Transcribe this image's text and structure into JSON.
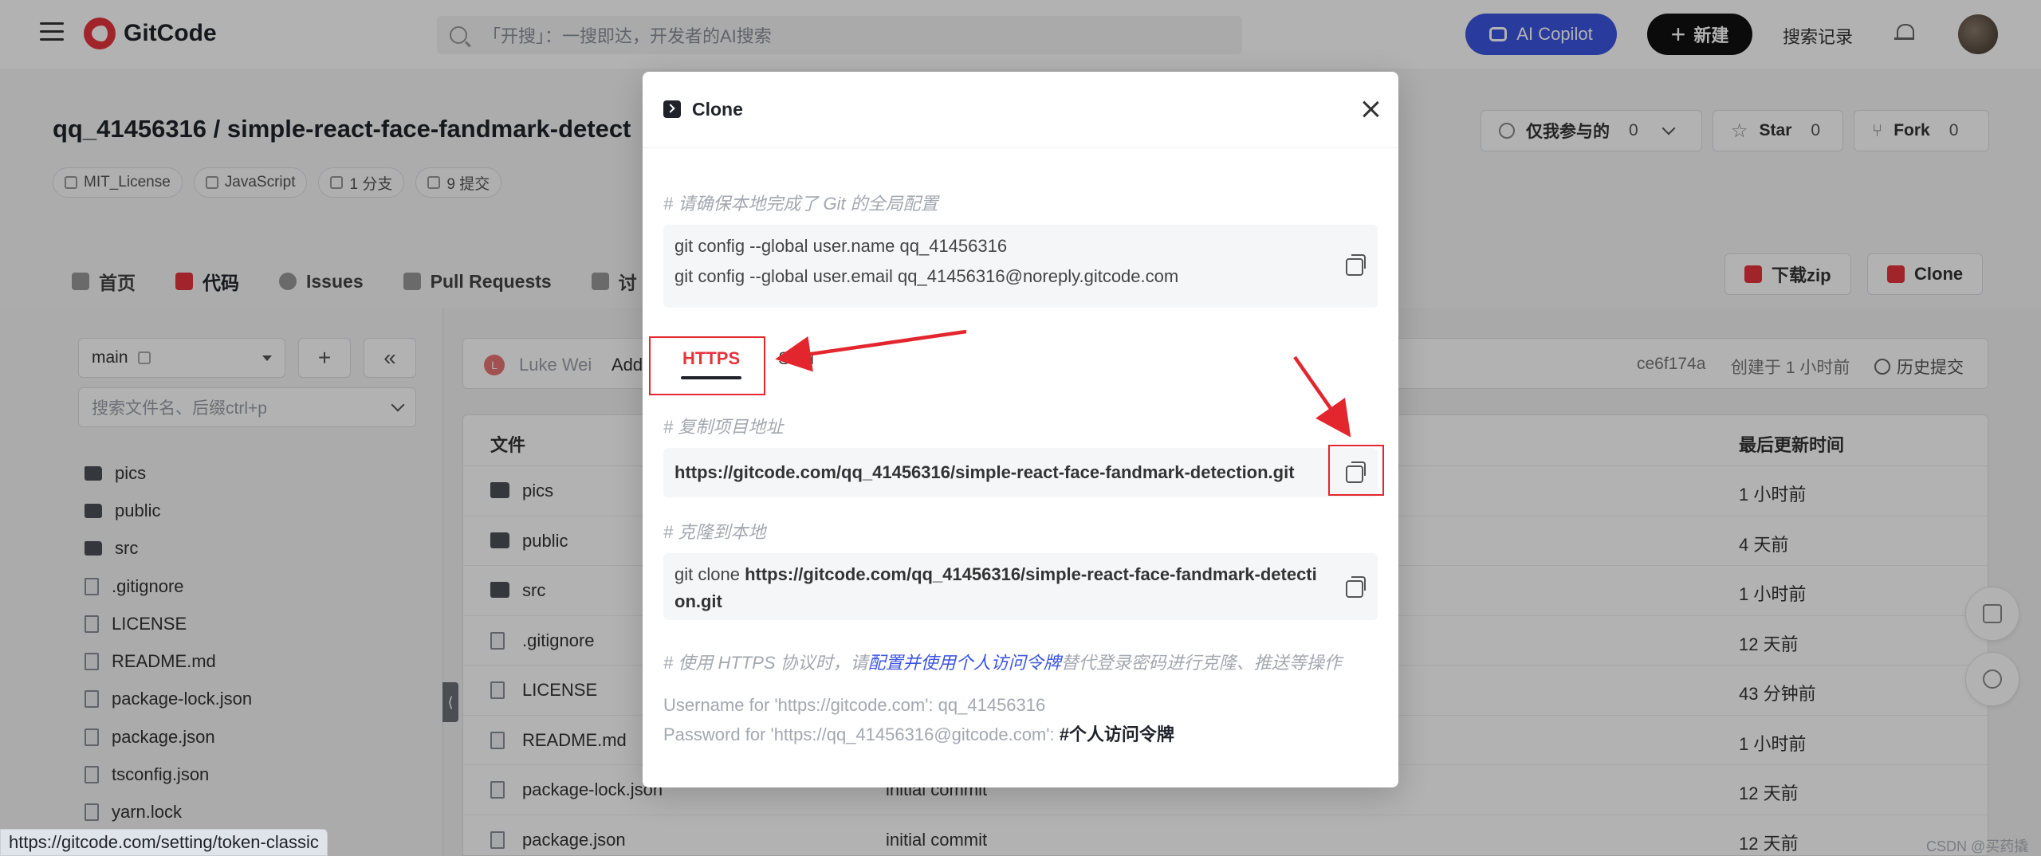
{
  "nav": {
    "logo_text": "GitCode",
    "search_placeholder": "「开搜」：一搜即达，开发者的AI搜索",
    "ai_copilot_label": "AI Copilot",
    "new_label": "新建",
    "search_history_label": "搜索记录"
  },
  "repo": {
    "title": "qq_41456316 / simple-react-face-fandmark-detect",
    "tags": [
      "MIT_License",
      "JavaScript",
      "1 分支",
      "9 提交"
    ],
    "watch_label": "仅我参与的",
    "watch_count": "0",
    "star_label": "Star",
    "star_count": "0",
    "fork_label": "Fork",
    "fork_count": "0"
  },
  "tabs": [
    {
      "label": "首页",
      "icon": "home-icon"
    },
    {
      "label": "代码",
      "icon": "code-icon",
      "active": true
    },
    {
      "label": "Issues",
      "icon": "issues-icon"
    },
    {
      "label": "Pull Requests",
      "icon": "pull-request-icon"
    },
    {
      "label": "讨",
      "icon": "discussion-icon"
    }
  ],
  "actions": {
    "download_zip_label": "下载zip",
    "clone_label": "Clone"
  },
  "sidebar": {
    "branch": "main",
    "file_search_placeholder": "搜索文件名、后缀ctrl+p",
    "tree": [
      {
        "name": "pics",
        "type": "folder"
      },
      {
        "name": "public",
        "type": "folder"
      },
      {
        "name": "src",
        "type": "folder"
      },
      {
        "name": ".gitignore",
        "type": "code"
      },
      {
        "name": "LICENSE",
        "type": "code"
      },
      {
        "name": "README.md",
        "type": "doc"
      },
      {
        "name": "package-lock.json",
        "type": "code"
      },
      {
        "name": "package.json",
        "type": "code"
      },
      {
        "name": "tsconfig.json",
        "type": "code"
      },
      {
        "name": "yarn.lock",
        "type": "doc"
      }
    ]
  },
  "commit_bar": {
    "avatar_letter": "L",
    "author": "Luke Wei",
    "message": "Add",
    "hash": "ce6f174a",
    "created": "创建于 1 小时前",
    "history_label": "历史提交"
  },
  "file_table": {
    "col_file": "文件",
    "col_updated": "最后更新时间",
    "rows": [
      {
        "name": "pics",
        "type": "folder",
        "msg": "",
        "time": "1 小时前"
      },
      {
        "name": "public",
        "type": "folder",
        "msg": "",
        "time": "4 天前"
      },
      {
        "name": "src",
        "type": "folder",
        "msg": "",
        "time": "1 小时前"
      },
      {
        "name": ".gitignore",
        "type": "code",
        "msg": "",
        "time": "12 天前"
      },
      {
        "name": "LICENSE",
        "type": "code",
        "msg": "",
        "time": "43 分钟前"
      },
      {
        "name": "README.md",
        "type": "doc",
        "msg": "",
        "time": "1 小时前"
      },
      {
        "name": "package-lock.json",
        "type": "code",
        "msg": "initial commit",
        "time": "12 天前"
      },
      {
        "name": "package.json",
        "type": "code",
        "msg": "initial commit",
        "time": "12 天前"
      }
    ]
  },
  "status_url": "https://gitcode.com/setting/token-classic",
  "watermark": "CSDN @买药撬撬",
  "modal": {
    "title": "Clone",
    "config_comment": "# 请确保本地完成了 Git 的全局配置",
    "config_line1": "git config --global user.name qq_41456316",
    "config_line2": "git config --global user.email qq_41456316@noreply.gitcode.com",
    "tab_https": "HTTPS",
    "tab_ssh": "SSH",
    "copy_url_comment": "# 复制项目地址",
    "repo_url": "https://gitcode.com/qq_41456316/simple-react-face-fandmark-detection.git",
    "clone_comment": "# 克隆到本地",
    "clone_cmd_prefix": "git clone ",
    "clone_cmd_url_line1": "https://gitcode.com/qq_41456316/simple-react-face-fandmark-detecti",
    "clone_cmd_url_line2": "on.git",
    "https_note_prefix": "# 使用 HTTPS 协议时，请",
    "https_note_link": "配置并使用个人访问令牌",
    "https_note_suffix": "替代登录密码进行克隆、推送等操作",
    "username_line": "Username for 'https://gitcode.com': qq_41456316",
    "password_prefix": "Password for 'https://qq_41456316@gitcode.com': ",
    "password_token": "#个人访问令牌"
  },
  "colors": {
    "brand_red": "#e5343d",
    "ai_blue": "#3d55e3",
    "annotation_red": "#e3262e"
  }
}
